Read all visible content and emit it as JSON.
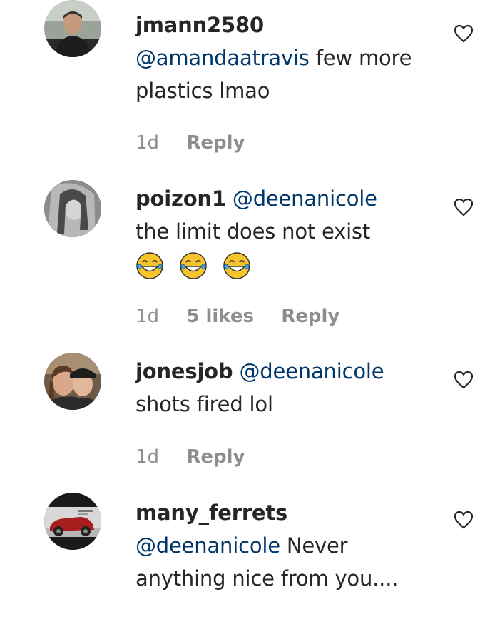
{
  "comments": [
    {
      "username": "jmann2580",
      "mention": "@amandaatravis",
      "text": "few more plastics lmao",
      "time": "1d",
      "likes": "",
      "reply": "Reply",
      "avatar": "profile-photo"
    },
    {
      "username": "poizon1",
      "mention": "@deenanicole",
      "text": "the limit does not exist",
      "emojis": [
        "laughing-tears-emoji",
        "laughing-tears-emoji",
        "laughing-tears-emoji"
      ],
      "time": "1d",
      "likes": "5 likes",
      "reply": "Reply",
      "avatar": "profile-photo"
    },
    {
      "username": "jonesjob",
      "mention": "@deenanicole",
      "text": "shots fired lol",
      "time": "1d",
      "likes": "",
      "reply": "Reply",
      "avatar": "profile-photo"
    },
    {
      "username": "many_ferrets",
      "mention": "@deenanicole",
      "text": "Never anything nice from you....",
      "time": "",
      "likes": "",
      "reply": "",
      "avatar": "profile-photo"
    }
  ],
  "colors": {
    "text": "#262626",
    "mention": "#00376b",
    "meta": "#8e8e8e"
  },
  "icons": {
    "like": "heart-outline-icon"
  }
}
